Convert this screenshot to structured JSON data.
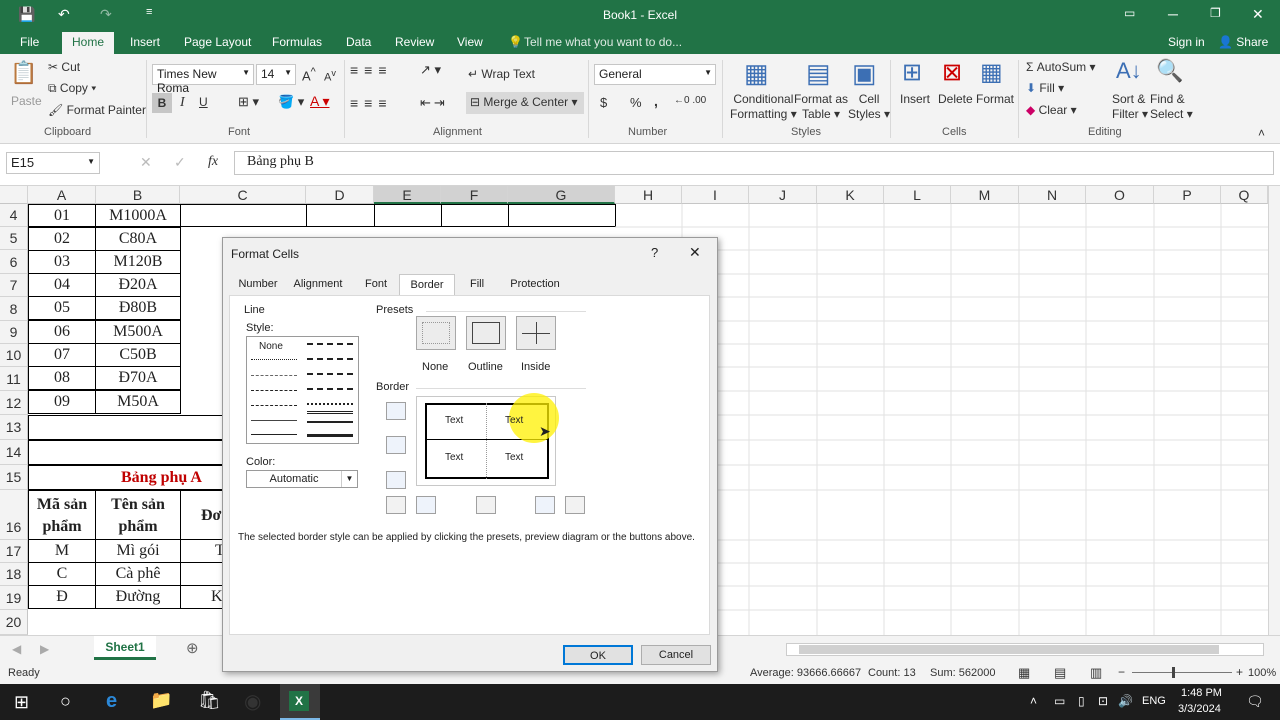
{
  "app": {
    "title": "Book1 - Excel",
    "search_hint": "Tell me what you want to do...",
    "sign_in": "Sign in",
    "share": "Share"
  },
  "tabs": [
    "File",
    "Home",
    "Insert",
    "Page Layout",
    "Formulas",
    "Data",
    "Review",
    "View"
  ],
  "ribbon": {
    "clipboard": {
      "paste": "Paste",
      "cut": "Cut",
      "copy": "Copy",
      "format_painter": "Format Painter",
      "group": "Clipboard"
    },
    "font": {
      "name": "Times New Roma",
      "size": "14",
      "group": "Font",
      "bold": "B",
      "italic": "I",
      "underline": "U"
    },
    "alignment": {
      "wrap": "Wrap Text",
      "merge": "Merge & Center",
      "group": "Alignment"
    },
    "number": {
      "format": "General",
      "group": "Number",
      "currency": "$",
      "percent": "%",
      "comma": ","
    },
    "styles": {
      "conditional": "Conditional",
      "conditional2": "Formatting",
      "format_table": "Format as",
      "format_table2": "Table",
      "cell_styles": "Cell",
      "cell_styles2": "Styles",
      "group": "Styles"
    },
    "cells": {
      "insert": "Insert",
      "delete": "Delete",
      "format": "Format",
      "group": "Cells"
    },
    "editing": {
      "autosum": "AutoSum",
      "fill": "Fill",
      "clear": "Clear",
      "sort": "Sort &",
      "sort2": "Filter",
      "find": "Find &",
      "find2": "Select",
      "group": "Editing"
    }
  },
  "formula_bar": {
    "name_box": "E15",
    "fx": "fx",
    "content": "Bảng phụ B"
  },
  "columns": [
    "A",
    "B",
    "C",
    "D",
    "E",
    "F",
    "G",
    "H",
    "I",
    "J",
    "K",
    "L",
    "M",
    "N",
    "O",
    "P",
    "Q"
  ],
  "rows": [
    {
      "n": "4",
      "a": "01",
      "b": "M1000A"
    },
    {
      "n": "5",
      "a": "02",
      "b": "C80A"
    },
    {
      "n": "6",
      "a": "03",
      "b": "M120B"
    },
    {
      "n": "7",
      "a": "04",
      "b": "Đ20A"
    },
    {
      "n": "8",
      "a": "05",
      "b": "Đ80B"
    },
    {
      "n": "9",
      "a": "06",
      "b": "M500A"
    },
    {
      "n": "10",
      "a": "07",
      "b": "C50B"
    },
    {
      "n": "11",
      "a": "08",
      "b": "Đ70A"
    },
    {
      "n": "12",
      "a": "09",
      "b": "M50A"
    }
  ],
  "extra_rows": [
    "13",
    "14",
    "15",
    "16",
    "17",
    "18",
    "19",
    "20"
  ],
  "bang_phu_a": {
    "title": "Bảng phụ A",
    "h1a": "Mã sản",
    "h1b": "phẩm",
    "h2a": "Tên sản",
    "h2b": "phẩm",
    "h3": "Đơ",
    "r17a": "M",
    "r17b": "Mì gói",
    "r17c": "T",
    "r18a": "C",
    "r18b": "Cà phê",
    "r19a": "Đ",
    "r19b": "Đường",
    "r19c": "K"
  },
  "sheet": {
    "tab": "Sheet1"
  },
  "status": {
    "ready": "Ready",
    "average": "Average: 93666.66667",
    "count": "Count: 13",
    "sum": "Sum: 562000",
    "zoom": "100%"
  },
  "taskbar": {
    "lang": "ENG",
    "time": "1:48 PM",
    "date": "3/3/2024"
  },
  "dialog": {
    "title": "Format Cells",
    "help": "?",
    "close": "✕",
    "tabs": [
      "Number",
      "Alignment",
      "Font",
      "Border",
      "Fill",
      "Protection"
    ],
    "line": "Line",
    "style": "Style:",
    "none": "None",
    "color": "Color:",
    "color_value": "Automatic",
    "presets": "Presets",
    "preset_labels": [
      "None",
      "Outline",
      "Inside"
    ],
    "border": "Border",
    "preview_text": [
      "Text",
      "Text",
      "Text",
      "Text"
    ],
    "hint": "The selected border style can be applied by clicking the presets, preview diagram or the buttons above.",
    "ok": "OK",
    "cancel": "Cancel"
  }
}
